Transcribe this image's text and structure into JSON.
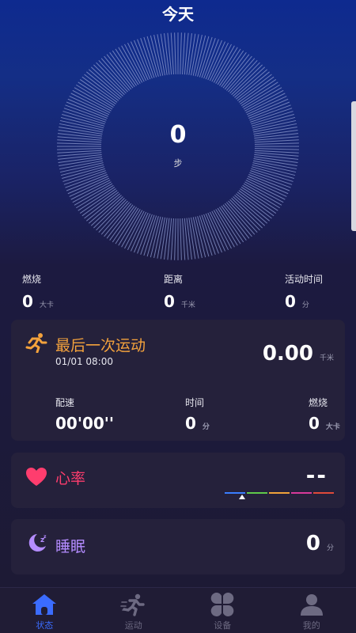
{
  "header": {
    "title": "今天"
  },
  "steps": {
    "value": "0",
    "unit": "步"
  },
  "stats": [
    {
      "label": "燃烧",
      "value": "0",
      "unit": "大卡"
    },
    {
      "label": "距离",
      "value": "0",
      "unit": "千米"
    },
    {
      "label": "活动时间",
      "value": "0",
      "unit": "分"
    }
  ],
  "last_workout": {
    "title": "最后一次运动",
    "date": "01/01 08:00",
    "distance": "0.00",
    "distance_unit": "千米",
    "pace_label": "配速",
    "pace_value": "00'00''",
    "time_label": "时间",
    "time_value": "0",
    "time_unit": "分",
    "burn_label": "燃烧",
    "burn_value": "0",
    "burn_unit": "大卡"
  },
  "heart_rate": {
    "title": "心率",
    "value": "--",
    "zone_colors": [
      "#3a7dff",
      "#5fc94a",
      "#f0a23a",
      "#d83a9a",
      "#e04a3a"
    ]
  },
  "sleep": {
    "title": "睡眠",
    "value": "0",
    "unit": "分"
  },
  "nav": [
    {
      "label": "状态",
      "icon": "home-icon",
      "active": true
    },
    {
      "label": "运动",
      "icon": "running-icon",
      "active": false
    },
    {
      "label": "设备",
      "icon": "device-icon",
      "active": false
    },
    {
      "label": "我的",
      "icon": "profile-icon",
      "active": false
    }
  ],
  "colors": {
    "accent_blue": "#3b6cff",
    "workout_orange": "#f4a23c",
    "heart_pink": "#ff3d6e",
    "sleep_purple": "#b48cff"
  }
}
